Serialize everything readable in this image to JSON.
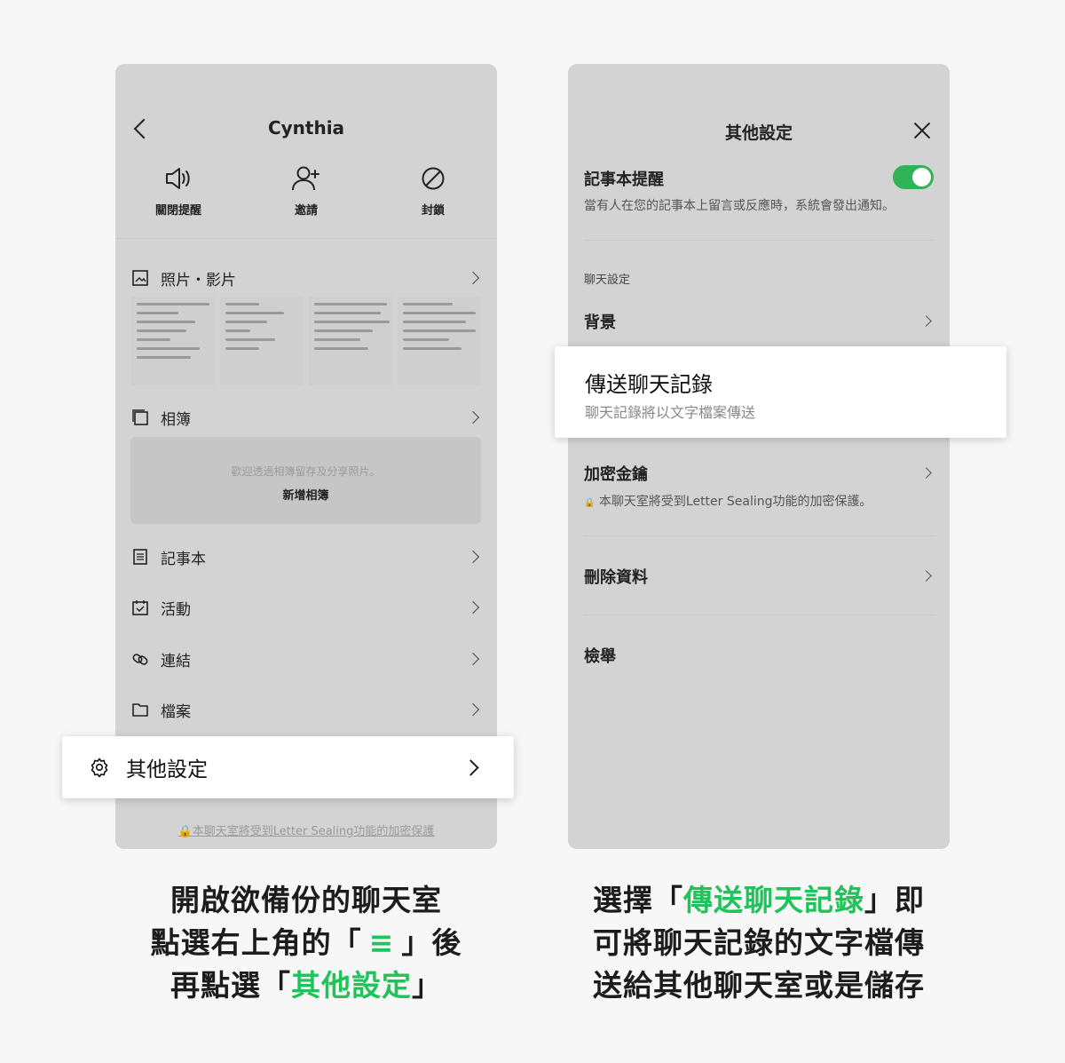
{
  "left_screen": {
    "title": "Cynthia",
    "actions": [
      {
        "label": "關閉提醒",
        "icon": "speaker-icon"
      },
      {
        "label": "邀請",
        "icon": "add-user-icon"
      },
      {
        "label": "封鎖",
        "icon": "block-icon"
      }
    ],
    "menu": {
      "photos": "照片・影片",
      "albums": "相簿",
      "notes": "記事本",
      "events": "活動",
      "links": "連結",
      "files": "檔案"
    },
    "album_hint": "歡迎透過相簿留存及分享照片。",
    "album_add": "新增相簿",
    "other_settings": "其他設定",
    "footer_note": "本聊天室將受到Letter Sealing功能的加密保護"
  },
  "right_screen": {
    "title": "其他設定",
    "note_alert": {
      "label": "記事本提醒",
      "desc": "當有人在您的記事本上留言或反應時，系統會發出通知。",
      "enabled": true
    },
    "section_chat": "聊天設定",
    "background": "背景",
    "send_history": {
      "label": "傳送聊天記錄",
      "desc": "聊天記錄將以文字檔案傳送"
    },
    "encryption": {
      "label": "加密金鑰",
      "desc": "本聊天室將受到Letter Sealing功能的加密保護。"
    },
    "delete_data": "刪除資料",
    "report": "檢舉"
  },
  "captions": {
    "left": {
      "line1": "開啟欲備份的聊天室",
      "line2_pre": "點選右上角的「",
      "line2_glyph": "≡",
      "line2_post": "」後",
      "line3_pre": "再點選「",
      "line3_highlight": "其他設定",
      "line3_post": "」"
    },
    "right": {
      "line1_pre": "選擇「",
      "line1_highlight": "傳送聊天記錄",
      "line1_post": "」即",
      "line2": "可將聊天記錄的文字檔傳",
      "line3": "送給其他聊天室或是儲存"
    }
  },
  "colors": {
    "accent_green": "#1ec35a",
    "toggle_green": "#2fb355",
    "phone_bg": "#d3d3d3",
    "page_bg": "#f7f7f7"
  }
}
